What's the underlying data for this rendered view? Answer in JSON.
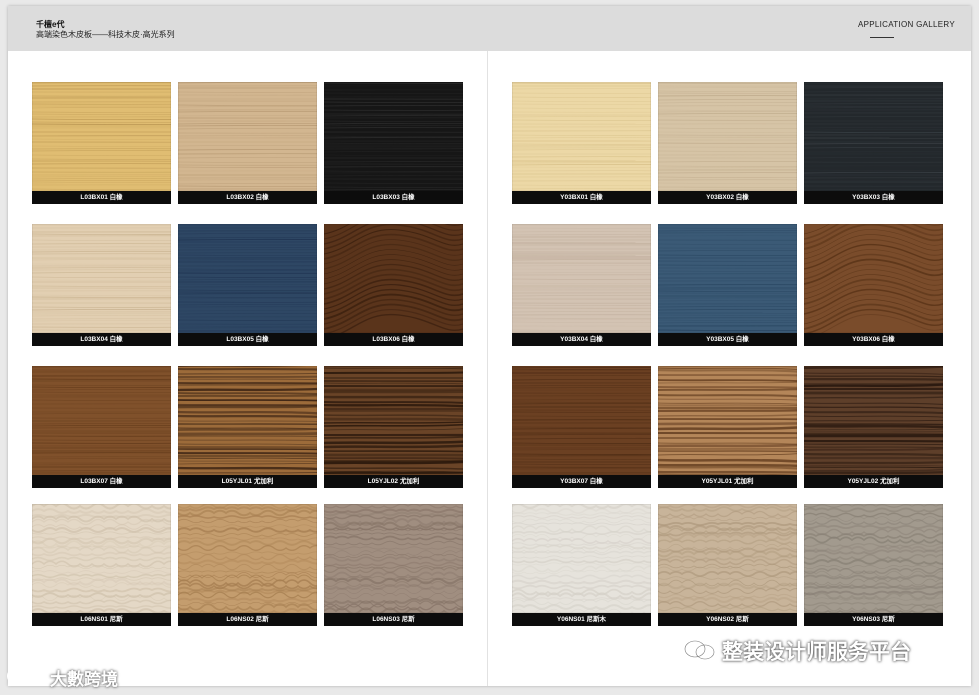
{
  "header": {
    "brand_name": "千檀e代",
    "brand_subtitle": "高端染色木皮板——科技木皮·高光系列",
    "gallery_title": "APPLICATION GALLERY"
  },
  "pages": [
    {
      "name": "left",
      "swatches": [
        {
          "code": "L03BX01 白橡",
          "base": "#e0bd72",
          "grain": "#b89450",
          "style": "fine"
        },
        {
          "code": "L03BX02 白橡",
          "base": "#d2b690",
          "grain": "#b39670",
          "style": "fine"
        },
        {
          "code": "L03BX03 白橡",
          "base": "#161616",
          "grain": "#333333",
          "style": "fine"
        },
        {
          "code": "L03BX04 白橡",
          "base": "#e2cfb2",
          "grain": "#c8b28f",
          "style": "fine"
        },
        {
          "code": "L03BX05 白橡",
          "base": "#2e4764",
          "grain": "#1f3350",
          "style": "fine"
        },
        {
          "code": "L03BX06 白橡",
          "base": "#5a341b",
          "grain": "#3b200f",
          "style": "cathedral"
        },
        {
          "code": "L03BX07 白橡",
          "base": "#80512b",
          "grain": "#5e3718",
          "style": "fine"
        },
        {
          "code": "L05YJL01 尤加利",
          "base": "#9c6b3a",
          "grain": "#3d2414",
          "style": "stripe"
        },
        {
          "code": "L05YJL02 尤加利",
          "base": "#6a4427",
          "grain": "#2a180c",
          "style": "stripe"
        },
        {
          "code": "L06NS01 尼斯",
          "base": "#e4d8c6",
          "grain": "#d0c2ad",
          "style": "wave"
        },
        {
          "code": "L06NS02 尼斯",
          "base": "#c49d6e",
          "grain": "#a57d50",
          "style": "wave"
        },
        {
          "code": "L06NS03 尼斯",
          "base": "#a08e80",
          "grain": "#857366",
          "style": "wave"
        }
      ]
    },
    {
      "name": "right",
      "swatches": [
        {
          "code": "Y03BX01 白橡",
          "base": "#ecd8a6",
          "grain": "#d6bf88",
          "style": "fine"
        },
        {
          "code": "Y03BX02 白橡",
          "base": "#d6c4a6",
          "grain": "#bda98a",
          "style": "fine"
        },
        {
          "code": "Y03BX03 白橡",
          "base": "#23282c",
          "grain": "#3a4045",
          "style": "fine"
        },
        {
          "code": "Y03BX04 白橡",
          "base": "#d3c3b3",
          "grain": "#bba996",
          "style": "fine"
        },
        {
          "code": "Y03BX05 白橡",
          "base": "#3b5a76",
          "grain": "#294661",
          "style": "fine"
        },
        {
          "code": "Y03BX06 白橡",
          "base": "#7a4c2b",
          "grain": "#5a3418",
          "style": "cathedral"
        },
        {
          "code": "Y03BX07 白橡",
          "base": "#6b4022",
          "grain": "#4b2a13",
          "style": "fine"
        },
        {
          "code": "Y05YJL01 尤加利",
          "base": "#b48659",
          "grain": "#6a4324",
          "style": "stripe"
        },
        {
          "code": "Y05YJL02 尤加利",
          "base": "#5e3f2a",
          "grain": "#2b1a10",
          "style": "stripe"
        },
        {
          "code": "Y06NS01 尼斯木",
          "base": "#e6e3dc",
          "grain": "#d5d1c9",
          "style": "wave"
        },
        {
          "code": "Y06NS02 尼斯",
          "base": "#c8b49a",
          "grain": "#ad987c",
          "style": "wave"
        },
        {
          "code": "Y06NS03 尼斯",
          "base": "#a29a8e",
          "grain": "#877f74",
          "style": "wave"
        }
      ]
    }
  ],
  "watermarks": {
    "platform": "整装设计师服务平台",
    "left_brand": "大數跨境",
    "platform_icon": "wechat-icon",
    "left_icon": "lang-logo-icon"
  }
}
